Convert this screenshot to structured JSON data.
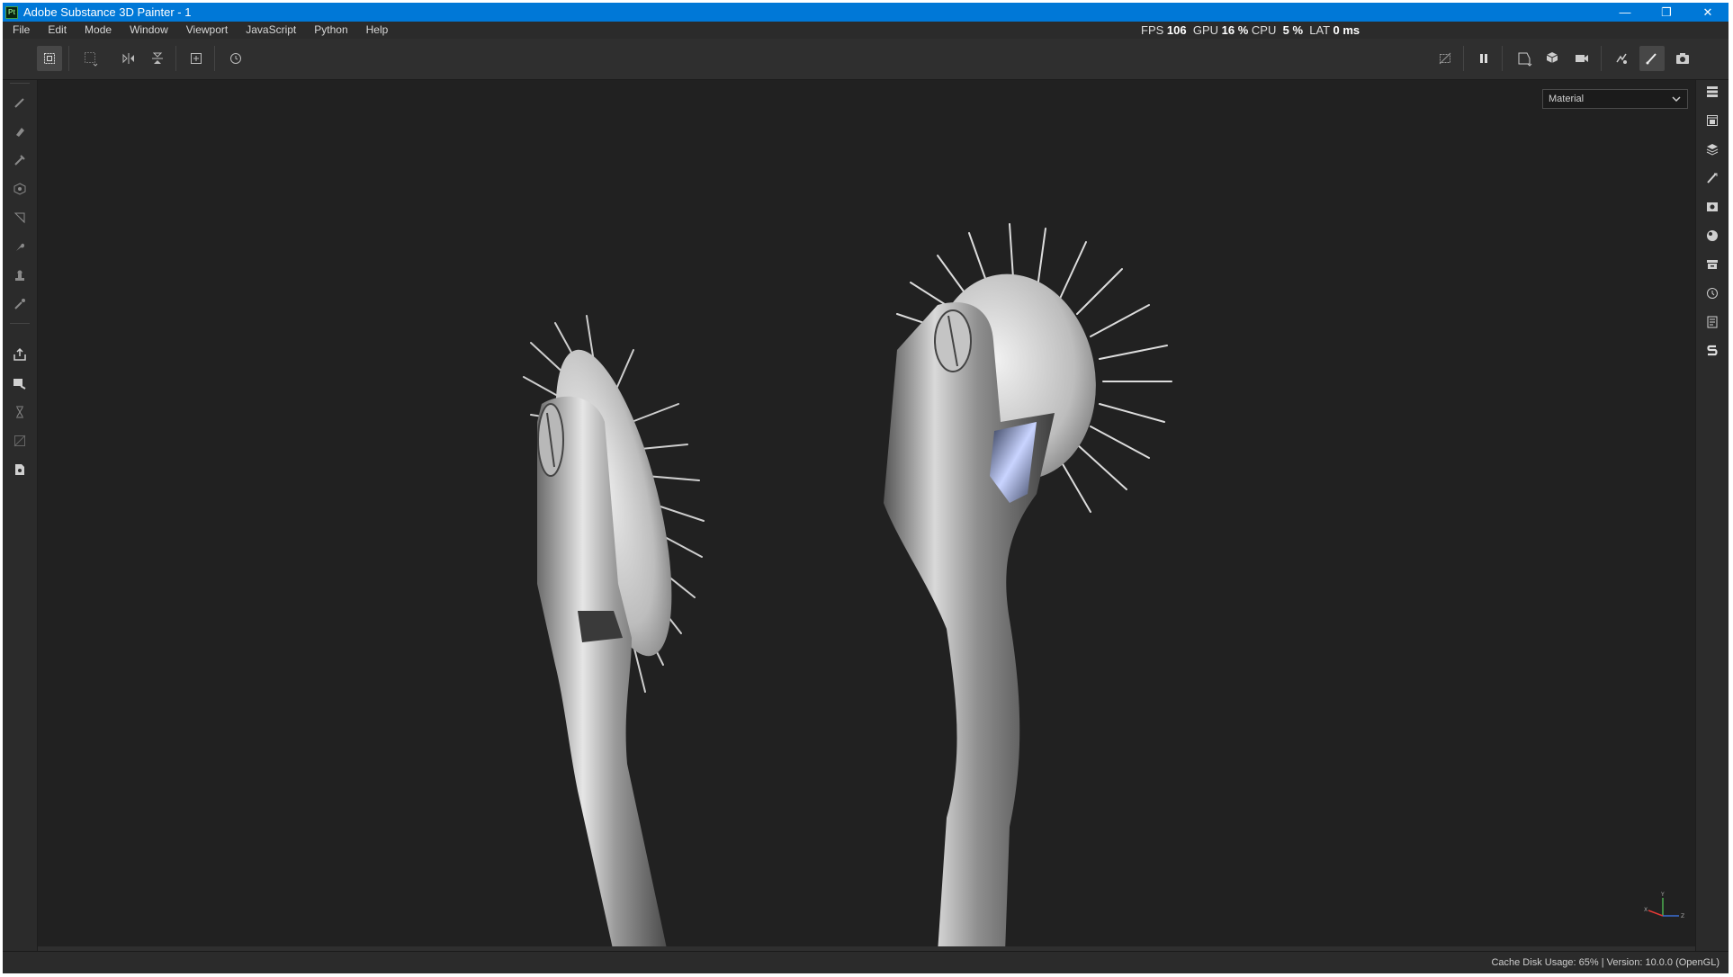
{
  "window": {
    "title": "Adobe Substance 3D Painter - 1",
    "app_badge": "Pt",
    "controls": {
      "minimize": "—",
      "restore": "❐",
      "close": "✕"
    }
  },
  "menu": {
    "items": [
      "File",
      "Edit",
      "Mode",
      "Window",
      "Viewport",
      "JavaScript",
      "Python",
      "Help"
    ]
  },
  "stats": {
    "fps_label": "FPS",
    "fps_value": "106",
    "gpu_label": "GPU",
    "gpu_value": "16 %",
    "cpu_label": "CPU",
    "cpu_value": "5 %",
    "lat_label": "LAT",
    "lat_value": "0 ms"
  },
  "toolbar": {
    "left_icons": [
      "transform-icon",
      "selection-icon",
      "mirror-x-icon",
      "mirror-y-icon",
      "frame-icon",
      "reset-icon"
    ],
    "right_icons": [
      "hide-icon",
      "pause-icon",
      "display-icon",
      "cube-icon",
      "camera-icon",
      "render-icon",
      "brush-icon",
      "screenshot-icon"
    ]
  },
  "left_tools": [
    "paint-icon",
    "eraser-icon",
    "projection-icon",
    "geometry-fill-icon",
    "polygon-fill-icon",
    "smudge-icon",
    "clone-icon",
    "color-picker-icon",
    "bake-icon",
    "material-picker-icon",
    "measure-icon",
    "uv-icon",
    "export-icon"
  ],
  "right_panels": [
    "layers-stack-icon",
    "texture-set-icon",
    "layers-icon",
    "properties-icon",
    "display-settings-icon",
    "shader-icon",
    "assets-icon",
    "history-icon",
    "log-icon",
    "substance-icon"
  ],
  "viewport": {
    "mode_select_value": "Material",
    "axis_labels": {
      "y": "Y",
      "x": "X",
      "z": "Z"
    }
  },
  "status": {
    "text": "Cache Disk Usage:   65% | Version: 10.0.0 (OpenGL)"
  },
  "colors": {
    "titlebar": "#0078d7",
    "viewport_bg": "#212121",
    "panel_bg": "#2b2b2b"
  }
}
